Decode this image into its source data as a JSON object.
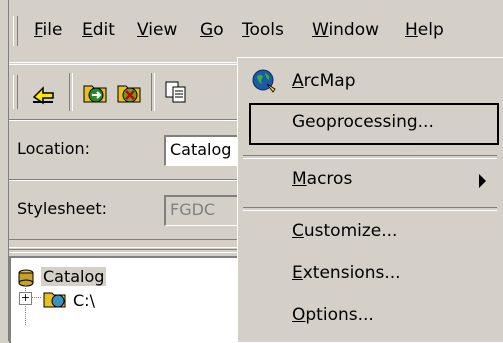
{
  "menubar": {
    "items": [
      {
        "label": "File",
        "mnemonic": "F",
        "rest": "ile"
      },
      {
        "label": "Edit",
        "mnemonic": "E",
        "rest": "dit"
      },
      {
        "label": "View",
        "mnemonic": "V",
        "rest": "iew"
      },
      {
        "label": "Go",
        "mnemonic": "G",
        "rest": "o"
      },
      {
        "label": "Tools",
        "mnemonic": "T",
        "rest": "ools"
      },
      {
        "label": "Window",
        "mnemonic": "W",
        "rest": "indow"
      },
      {
        "label": "Help",
        "mnemonic": "H",
        "rest": "elp"
      }
    ]
  },
  "toolbar": {
    "icons": [
      "up-one-level-icon",
      "connect-folder-icon",
      "disconnect-folder-icon",
      "copy-icon"
    ]
  },
  "location": {
    "label": "Location:",
    "value": "Catalog"
  },
  "stylesheet": {
    "label": "Stylesheet:",
    "value": "FGDC"
  },
  "tree": {
    "root": "Catalog",
    "child": "C:\\"
  },
  "tools_menu": {
    "arcmap": {
      "pre": "",
      "mn": "A",
      "post": "rcMap"
    },
    "geoprocessing": {
      "label": "Geoprocessing..."
    },
    "macros": {
      "pre": "",
      "mn": "M",
      "post": "acros"
    },
    "customize": {
      "pre": "",
      "mn": "C",
      "post": "ustomize..."
    },
    "extensions": {
      "pre": "",
      "mn": "E",
      "post": "xtensions..."
    },
    "options": {
      "pre": "",
      "mn": "O",
      "post": "ptions..."
    }
  },
  "colors": {
    "face": "#d4d0c8",
    "shadow": "#808080",
    "highlight": "#ffffff"
  }
}
